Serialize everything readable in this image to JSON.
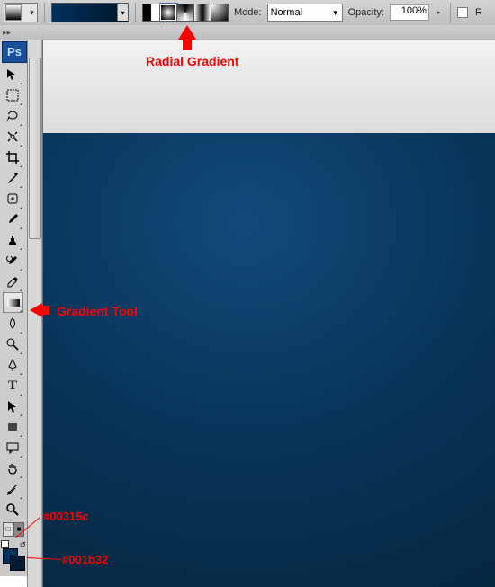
{
  "options_bar": {
    "mode_label": "Mode:",
    "mode_value": "Normal",
    "opacity_label": "Opacity:",
    "opacity_value": "100%",
    "reverse_short": "R"
  },
  "gradient_types": [
    "Linear",
    "Radial",
    "Angle",
    "Reflected",
    "Diamond"
  ],
  "toolbox": {
    "app_badge": "Ps",
    "tools": [
      "move",
      "rect-marquee",
      "lasso",
      "quick-selection",
      "crop",
      "eyedropper",
      "healing-brush",
      "brush",
      "clone-stamp",
      "history-brush",
      "eraser",
      "gradient",
      "blur",
      "dodge",
      "pen",
      "type",
      "path-selection",
      "rectangle",
      "hand",
      "notes",
      "color-sampler",
      "zoom"
    ],
    "fg_color": "#00315c",
    "bg_color": "#001b32"
  },
  "annotations": {
    "a1": "Radial Gradient",
    "a2": "Gradient Tool",
    "a3": "#00315c",
    "a4": "#001b32"
  }
}
